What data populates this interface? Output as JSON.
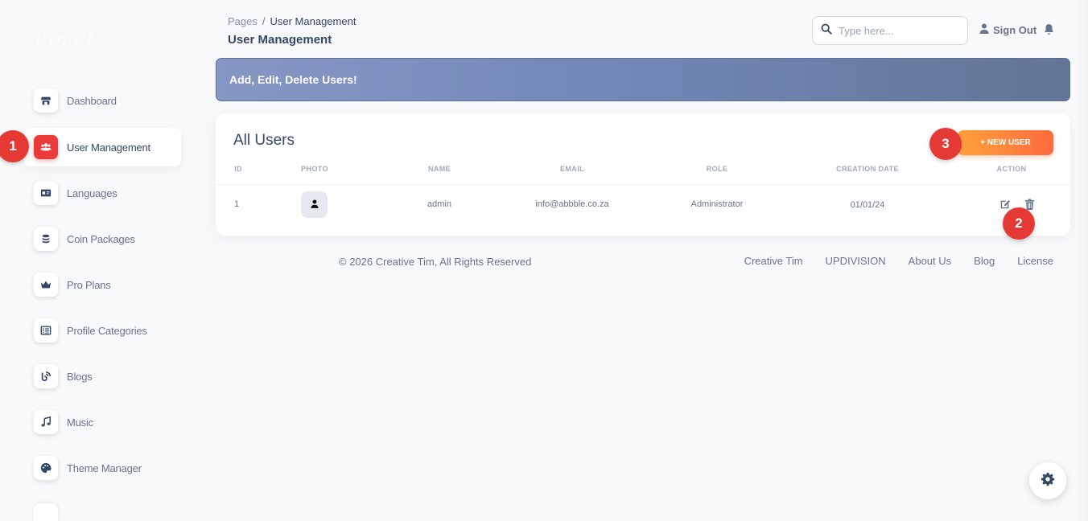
{
  "brand": {
    "logo_text": "kimat"
  },
  "sidebar": {
    "items": [
      {
        "label": "Dashboard",
        "icon": "shop-icon"
      },
      {
        "label": "User Management",
        "icon": "users-icon",
        "active": true
      },
      {
        "label": "Languages",
        "icon": "id-card-icon"
      },
      {
        "label": "Coin Packages",
        "icon": "coins-icon"
      },
      {
        "label": "Pro Plans",
        "icon": "crown-icon"
      },
      {
        "label": "Profile Categories",
        "icon": "list-icon"
      },
      {
        "label": "Blogs",
        "icon": "blog-icon"
      },
      {
        "label": "Music",
        "icon": "music-icon"
      },
      {
        "label": "Theme Manager",
        "icon": "palette-icon"
      }
    ]
  },
  "header": {
    "breadcrumb": {
      "parent": "Pages",
      "separator": "/",
      "current": "User Management"
    },
    "title": "User Management",
    "search_placeholder": "Type here...",
    "sign_out": "Sign Out"
  },
  "banner": {
    "text": "Add, Edit, Delete Users!"
  },
  "users_card": {
    "title": "All Users",
    "new_user_label": "+ NEW USER",
    "columns": [
      "ID",
      "PHOTO",
      "NAME",
      "EMAIL",
      "ROLE",
      "CREATION DATE",
      "ACTION"
    ],
    "rows": [
      {
        "id": "1",
        "name": "admin",
        "email": "info@abbble.co.za",
        "role": "Administrator",
        "created": "01/01/24"
      }
    ]
  },
  "footer": {
    "copyright": "© 2026 Creative Tim, All Rights Reserved",
    "links": [
      "Creative Tim",
      "UPDIVISION",
      "About Us",
      "Blog",
      "License"
    ]
  },
  "annotations": [
    "1",
    "2",
    "3"
  ],
  "colors": {
    "accent_red": "#ea3b3b",
    "badge_red": "#e53935",
    "button_orange_start": "#ffa23a",
    "button_orange_end": "#ff6b3d",
    "banner_start": "#8797c4",
    "banner_end": "#627596"
  }
}
